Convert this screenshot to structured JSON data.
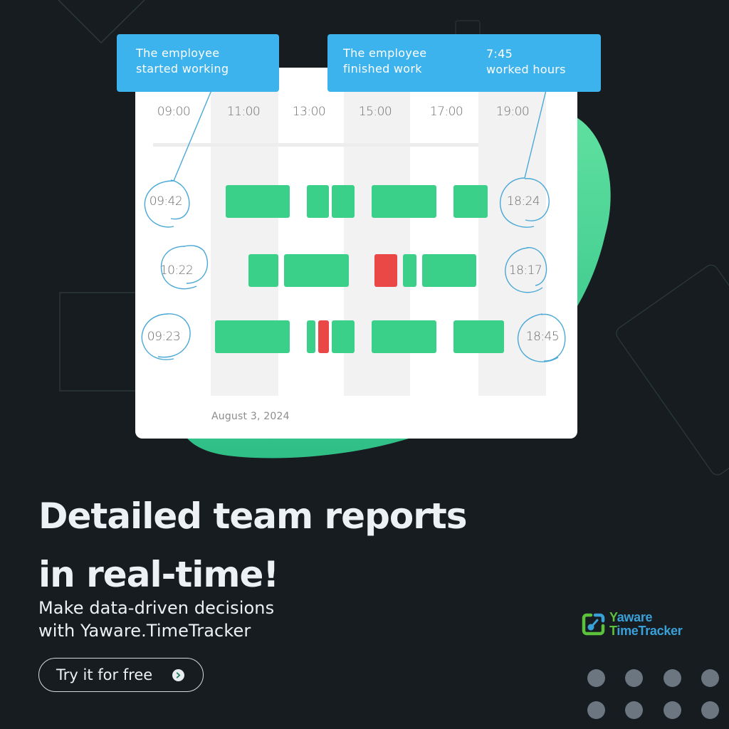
{
  "callouts": {
    "start": {
      "text": "The employee\nstarted working"
    },
    "finish": {
      "text": "The employee\nfinished work"
    },
    "worked": {
      "text": "7:45\nworked hours"
    }
  },
  "report": {
    "hours": [
      "09:00",
      "11:00",
      "13:00",
      "15:00",
      "17:00",
      "19:00"
    ],
    "date": "August 3, 2024",
    "rows": [
      {
        "start": "09:42",
        "end": "18:24",
        "segments": [
          {
            "from": "09:42",
            "to": "11:35",
            "status": "work"
          },
          {
            "from": "12:05",
            "to": "12:45",
            "status": "work"
          },
          {
            "from": "12:50",
            "to": "13:30",
            "status": "work"
          },
          {
            "from": "14:00",
            "to": "15:55",
            "status": "work"
          },
          {
            "from": "16:25",
            "to": "17:25",
            "status": "work"
          }
        ]
      },
      {
        "start": "10:22",
        "end": "18:17",
        "segments": [
          {
            "from": "10:22",
            "to": "11:15",
            "status": "work"
          },
          {
            "from": "11:25",
            "to": "13:20",
            "status": "work"
          },
          {
            "from": "14:05",
            "to": "14:45",
            "status": "idle"
          },
          {
            "from": "14:55",
            "to": "15:20",
            "status": "work"
          },
          {
            "from": "15:30",
            "to": "17:05",
            "status": "work"
          }
        ]
      },
      {
        "start": "09:23",
        "end": "18:45",
        "segments": [
          {
            "from": "09:23",
            "to": "11:35",
            "status": "work"
          },
          {
            "from": "12:05",
            "to": "12:20",
            "status": "work"
          },
          {
            "from": "12:25",
            "to": "12:45",
            "status": "idle"
          },
          {
            "from": "12:50",
            "to": "13:30",
            "status": "work"
          },
          {
            "from": "14:00",
            "to": "15:55",
            "status": "work"
          },
          {
            "from": "16:25",
            "to": "17:55",
            "status": "work"
          }
        ]
      }
    ]
  },
  "headline": {
    "line1": "Detailed team reports",
    "line2": "in real-time!"
  },
  "subline": {
    "line1": "Make data-driven decisions",
    "line2": "with Yaware.TimeTracker"
  },
  "cta": {
    "label": "Try it for free",
    "icon": "chevron-right-icon"
  },
  "logo": {
    "first_letter_1": "Y",
    "rest_1": "aware",
    "first_letter_2": "T",
    "rest_2": "imeTracker"
  },
  "colors": {
    "background": "#161c20",
    "callout": "#3db3ee",
    "work": "#3ad08a",
    "idle": "#ea4747",
    "accent_green": "#3ad08a",
    "logo_blue": "#3aa0d8",
    "logo_green": "#5cc23c"
  }
}
